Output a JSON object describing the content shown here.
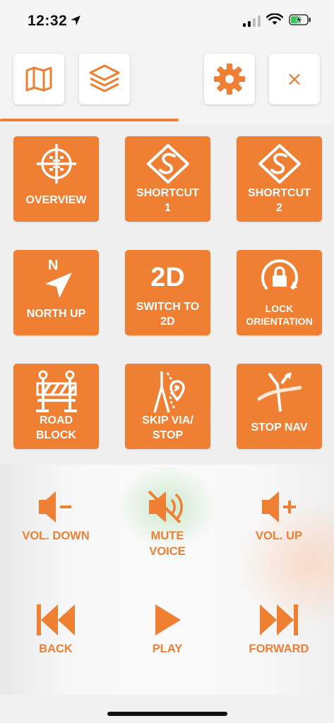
{
  "status_bar": {
    "time": "12:32",
    "icons": [
      "location-arrow-icon",
      "cellular-signal-icon",
      "wifi-icon",
      "battery-charging-icon"
    ]
  },
  "toolbar": {
    "buttons": [
      "map-icon",
      "layers-icon",
      "gear-icon",
      "close-icon"
    ],
    "close_glyph": "×",
    "accent": "#ee7f33"
  },
  "grid": {
    "tiles": [
      {
        "label": "OVERVIEW",
        "icon": "overview-crosshair-icon"
      },
      {
        "label": "SHORTCUT\n1",
        "icon": "shortcut-icon"
      },
      {
        "label": "SHORTCUT\n2",
        "icon": "shortcut-icon"
      },
      {
        "label": "NORTH UP",
        "icon": "north-arrow-icon",
        "icon_text": "N"
      },
      {
        "label": "SWITCH TO\n2D",
        "icon": "2d-text-icon",
        "icon_text": "2D"
      },
      {
        "label": "LOCK\nORIENTATION",
        "icon": "lock-rotate-icon"
      },
      {
        "label": "ROAD\nBLOCK",
        "icon": "road-block-icon"
      },
      {
        "label": "SKIP VIA/\nSTOP",
        "icon": "skip-via-icon"
      },
      {
        "label": "STOP NAV",
        "icon": "stop-nav-icon"
      }
    ]
  },
  "media": {
    "vol_down": "VOL. DOWN",
    "mute_voice": "MUTE\nVOICE",
    "vol_up": "VOL. UP",
    "back": "BACK",
    "play": "PLAY",
    "forward": "FORWARD"
  },
  "colors": {
    "accent": "#ee7f33",
    "tile_text": "#ffffff",
    "background": "#f2f2f2"
  }
}
